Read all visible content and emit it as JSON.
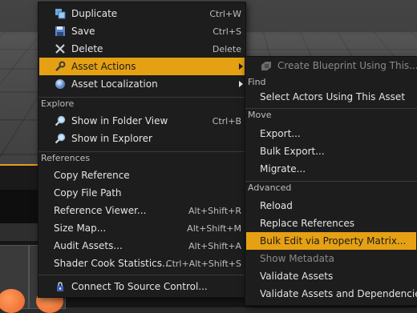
{
  "main_menu": {
    "items": [
      {
        "label": "Duplicate",
        "shortcut": "Ctrl+W",
        "icon": "duplicate-icon"
      },
      {
        "label": "Save",
        "shortcut": "Ctrl+S",
        "icon": "save-icon"
      },
      {
        "label": "Delete",
        "shortcut": "Delete",
        "icon": "delete-icon"
      },
      {
        "label": "Asset Actions",
        "icon": "wrench-icon",
        "submenu": true,
        "highlighted": true
      },
      {
        "label": "Asset Localization",
        "icon": "globe-icon",
        "submenu": true
      }
    ],
    "explore": {
      "title": "Explore",
      "items": [
        {
          "label": "Show in Folder View",
          "shortcut": "Ctrl+B",
          "icon": "magnifier-icon"
        },
        {
          "label": "Show in Explorer",
          "icon": "magnifier-icon"
        }
      ]
    },
    "references": {
      "title": "References",
      "items": [
        {
          "label": "Copy Reference"
        },
        {
          "label": "Copy File Path"
        },
        {
          "label": "Reference Viewer...",
          "shortcut": "Alt+Shift+R"
        },
        {
          "label": "Size Map...",
          "shortcut": "Alt+Shift+M"
        },
        {
          "label": "Audit Assets...",
          "shortcut": "Alt+Shift+A"
        },
        {
          "label": "Shader Cook Statistics...",
          "shortcut": "Ctrl+Alt+Shift+S"
        }
      ]
    },
    "source_control": {
      "label": "Connect To Source Control...",
      "icon": "source-control-icon"
    }
  },
  "sub_menu": {
    "top": {
      "label": "Create Blueprint Using This...",
      "icon": "blueprint-icon",
      "disabled": true
    },
    "find": {
      "title": "Find",
      "items": [
        {
          "label": "Select Actors Using This Asset"
        }
      ]
    },
    "move": {
      "title": "Move",
      "items": [
        {
          "label": "Export..."
        },
        {
          "label": "Bulk Export..."
        },
        {
          "label": "Migrate..."
        }
      ]
    },
    "advanced": {
      "title": "Advanced",
      "items": [
        {
          "label": "Reload"
        },
        {
          "label": "Replace References"
        },
        {
          "label": "Bulk Edit via Property Matrix...",
          "highlighted": true
        },
        {
          "label": "Show Metadata",
          "disabled": true
        },
        {
          "label": "Validate Assets"
        },
        {
          "label": "Validate Assets and Dependencies"
        }
      ]
    }
  },
  "colors": {
    "highlight": "#e5a113",
    "menu_bg": "#1d1d1d",
    "accent_line": "#e89a20"
  }
}
